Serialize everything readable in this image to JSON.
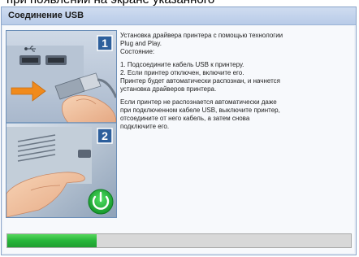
{
  "page_caption": "при появлении на экране указанного",
  "window": {
    "title": "Соединение USB"
  },
  "illustration": {
    "step1_label": "1",
    "step2_label": "2",
    "icons": [
      "usb-cable-icon",
      "arrow-right-icon",
      "power-button-icon"
    ]
  },
  "content": {
    "intro_lines": [
      "Установка драйвера принтера с помощью технологии",
      "Plug and Play."
    ],
    "status_label": "Состояние:",
    "steps_lines": [
      "1. Подсоедините кабель USB к принтеру.",
      "2. Если принтер отключен, включите его.",
      "Принтер будет автоматически распознан, и начнется",
      "установка драйверов принтера."
    ],
    "note_lines": [
      "Если принтер не распознается автоматически даже",
      "при подключенном кабеле USB, выключите принтер,",
      "отсоедините от него кабель, а затем снова",
      "подключите его."
    ]
  },
  "progress": {
    "fraction": 0.26,
    "colors": {
      "fill": "#2fbf3f",
      "track": "#d8d8d8"
    }
  },
  "colors": {
    "title_bar": "#c4d4ec",
    "window_bg": "#f7f9fc",
    "panel_blue": "#3c6ea8",
    "power_green": "#2fbf3f"
  }
}
